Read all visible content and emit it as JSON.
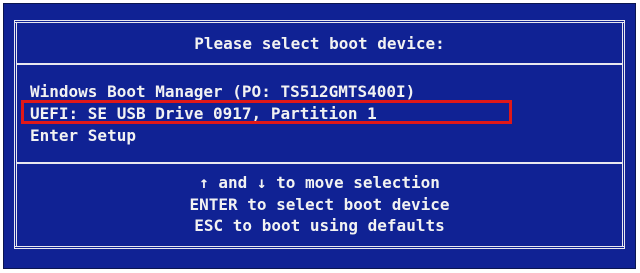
{
  "dialog": {
    "title": "Please select boot device:"
  },
  "boot_items": [
    {
      "label": "Windows Boot Manager (PO: TS512GMTS400I)"
    },
    {
      "label": "UEFI: SE USB Drive 0917, Partition 1"
    },
    {
      "label": "Enter Setup"
    }
  ],
  "highlighted_item_index": 1,
  "help": [
    {
      "text": "↑ and ↓ to move selection"
    },
    {
      "text": "ENTER to select boot device"
    },
    {
      "text": "ESC to boot using defaults"
    }
  ],
  "colors": {
    "background": "#102294",
    "text": "#f2f2f2",
    "highlight_border": "#e01818"
  }
}
